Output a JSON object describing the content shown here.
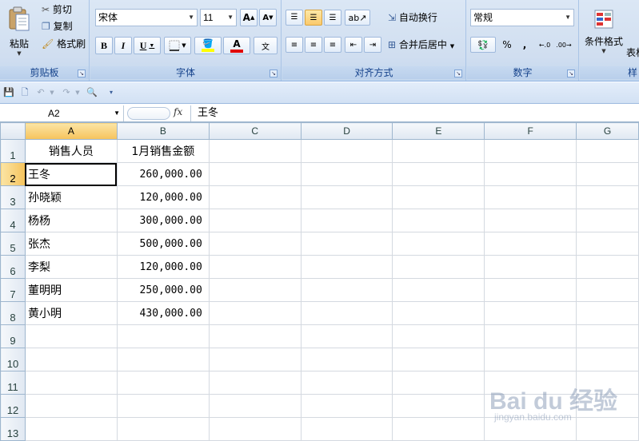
{
  "ribbon": {
    "clipboard": {
      "label": "剪贴板",
      "paste": "粘贴",
      "cut": "剪切",
      "copy": "复制",
      "format_painter": "格式刷"
    },
    "font": {
      "label": "字体",
      "font_name": "宋体",
      "font_size": "11",
      "bold": "B",
      "italic": "I",
      "underline": "U",
      "grow": "A",
      "shrink": "A"
    },
    "alignment": {
      "label": "对齐方式",
      "wrap_text": "自动换行",
      "merge_center": "合并后居中"
    },
    "number": {
      "label": "数字",
      "format": "常规",
      "percent": "%",
      "comma": ","
    },
    "styles": {
      "conditional_format": "条件格式",
      "table_format_partial": "表格",
      "cut_label": "样"
    }
  },
  "formula_bar": {
    "name_box": "A2",
    "fx": "fx",
    "content": "王冬"
  },
  "grid": {
    "columns": [
      "A",
      "B",
      "C",
      "D",
      "E",
      "F",
      "G"
    ],
    "rows": [
      {
        "n": "1",
        "a": "销售人员",
        "b": "1月销售金额"
      },
      {
        "n": "2",
        "a": "王冬",
        "b": "260,000.00"
      },
      {
        "n": "3",
        "a": "孙晓颖",
        "b": "120,000.00"
      },
      {
        "n": "4",
        "a": "杨杨",
        "b": "300,000.00"
      },
      {
        "n": "5",
        "a": "张杰",
        "b": "500,000.00"
      },
      {
        "n": "6",
        "a": "李梨",
        "b": "120,000.00"
      },
      {
        "n": "7",
        "a": "董明明",
        "b": "250,000.00"
      },
      {
        "n": "8",
        "a": "黄小明",
        "b": "430,000.00"
      },
      {
        "n": "9",
        "a": "",
        "b": ""
      },
      {
        "n": "10",
        "a": "",
        "b": ""
      },
      {
        "n": "11",
        "a": "",
        "b": ""
      },
      {
        "n": "12",
        "a": "",
        "b": ""
      },
      {
        "n": "13",
        "a": "",
        "b": ""
      }
    ]
  },
  "watermark": {
    "text": "Bai du 经验",
    "url": "jingyan.baidu.com"
  },
  "colors": {
    "ribbon_bg": "#d0def0",
    "selection_header": "#f6c35c",
    "font_color_red": "#e00000",
    "fill_yellow": "#ffff00"
  }
}
